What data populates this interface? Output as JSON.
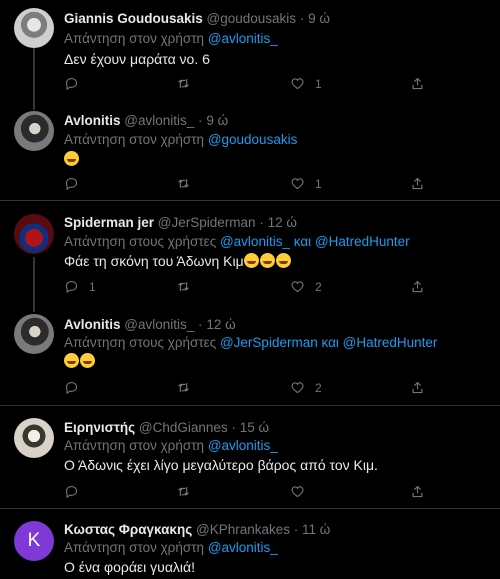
{
  "tweets": [
    {
      "name": "Giannis Goudousakis",
      "handle": "@goudousakis",
      "time": "9 ώ",
      "reply_label": "Απάντηση στον χρήστη",
      "reply_to_1": "@avlonitis_",
      "text": "Δεν έχουν μαράτα νο. 6",
      "counts": {
        "reply": "",
        "retweet": "",
        "like": "1",
        "share": ""
      }
    },
    {
      "name": "Avlonitis",
      "handle": "@avlonitis_",
      "time": "9 ώ",
      "reply_label": "Απάντηση στον χρήστη",
      "reply_to_1": "@goudousakis",
      "emojis": [
        "rofl"
      ],
      "counts": {
        "reply": "",
        "retweet": "",
        "like": "1",
        "share": ""
      }
    },
    {
      "name": "Spiderman jer",
      "handle": "@JerSpiderman",
      "time": "12 ώ",
      "reply_label": "Απάντηση στους χρήστες",
      "reply_to_1": "@avlonitis_",
      "reply_conj": "και",
      "reply_to_2": "@HatredHunter",
      "text": "Φάε τη σκόνη του Άδωνη Κιμ",
      "emojis": [
        "joy",
        "joy",
        "joy"
      ],
      "counts": {
        "reply": "1",
        "retweet": "",
        "like": "2",
        "share": ""
      }
    },
    {
      "name": "Avlonitis",
      "handle": "@avlonitis_",
      "time": "12 ώ",
      "reply_label": "Απάντηση στους χρήστες",
      "reply_to_1": "@JerSpiderman",
      "reply_conj": "και",
      "reply_to_2": "@HatredHunter",
      "emojis": [
        "rofl",
        "rofl"
      ],
      "counts": {
        "reply": "",
        "retweet": "",
        "like": "2",
        "share": ""
      }
    },
    {
      "name": "Ειρηνιστής",
      "handle": "@ChdGiannes",
      "time": "15 ώ",
      "reply_label": "Απάντηση στον χρήστη",
      "reply_to_1": "@avlonitis_",
      "text": "Ο Άδωνις έχει λίγο μεγαλύτερο βάρος από τον Κιμ.",
      "counts": {
        "reply": "",
        "retweet": "",
        "like": "",
        "share": ""
      }
    },
    {
      "name": "Κωστας Φραγκακης",
      "handle": "@KPhrankakes",
      "time": "11 ώ",
      "avatar_letter": "K",
      "reply_label": "Απάντηση στον χρήστη",
      "reply_to_1": "@avlonitis_",
      "text": "Ο ένα φοράει γυαλιά!"
    }
  ],
  "colors": {
    "background": "#000000",
    "accent": "#1d9bf0",
    "muted": "#71767b",
    "text": "#e7e9ea"
  },
  "icons": [
    "reply-icon",
    "retweet-icon",
    "like-icon",
    "share-icon"
  ]
}
